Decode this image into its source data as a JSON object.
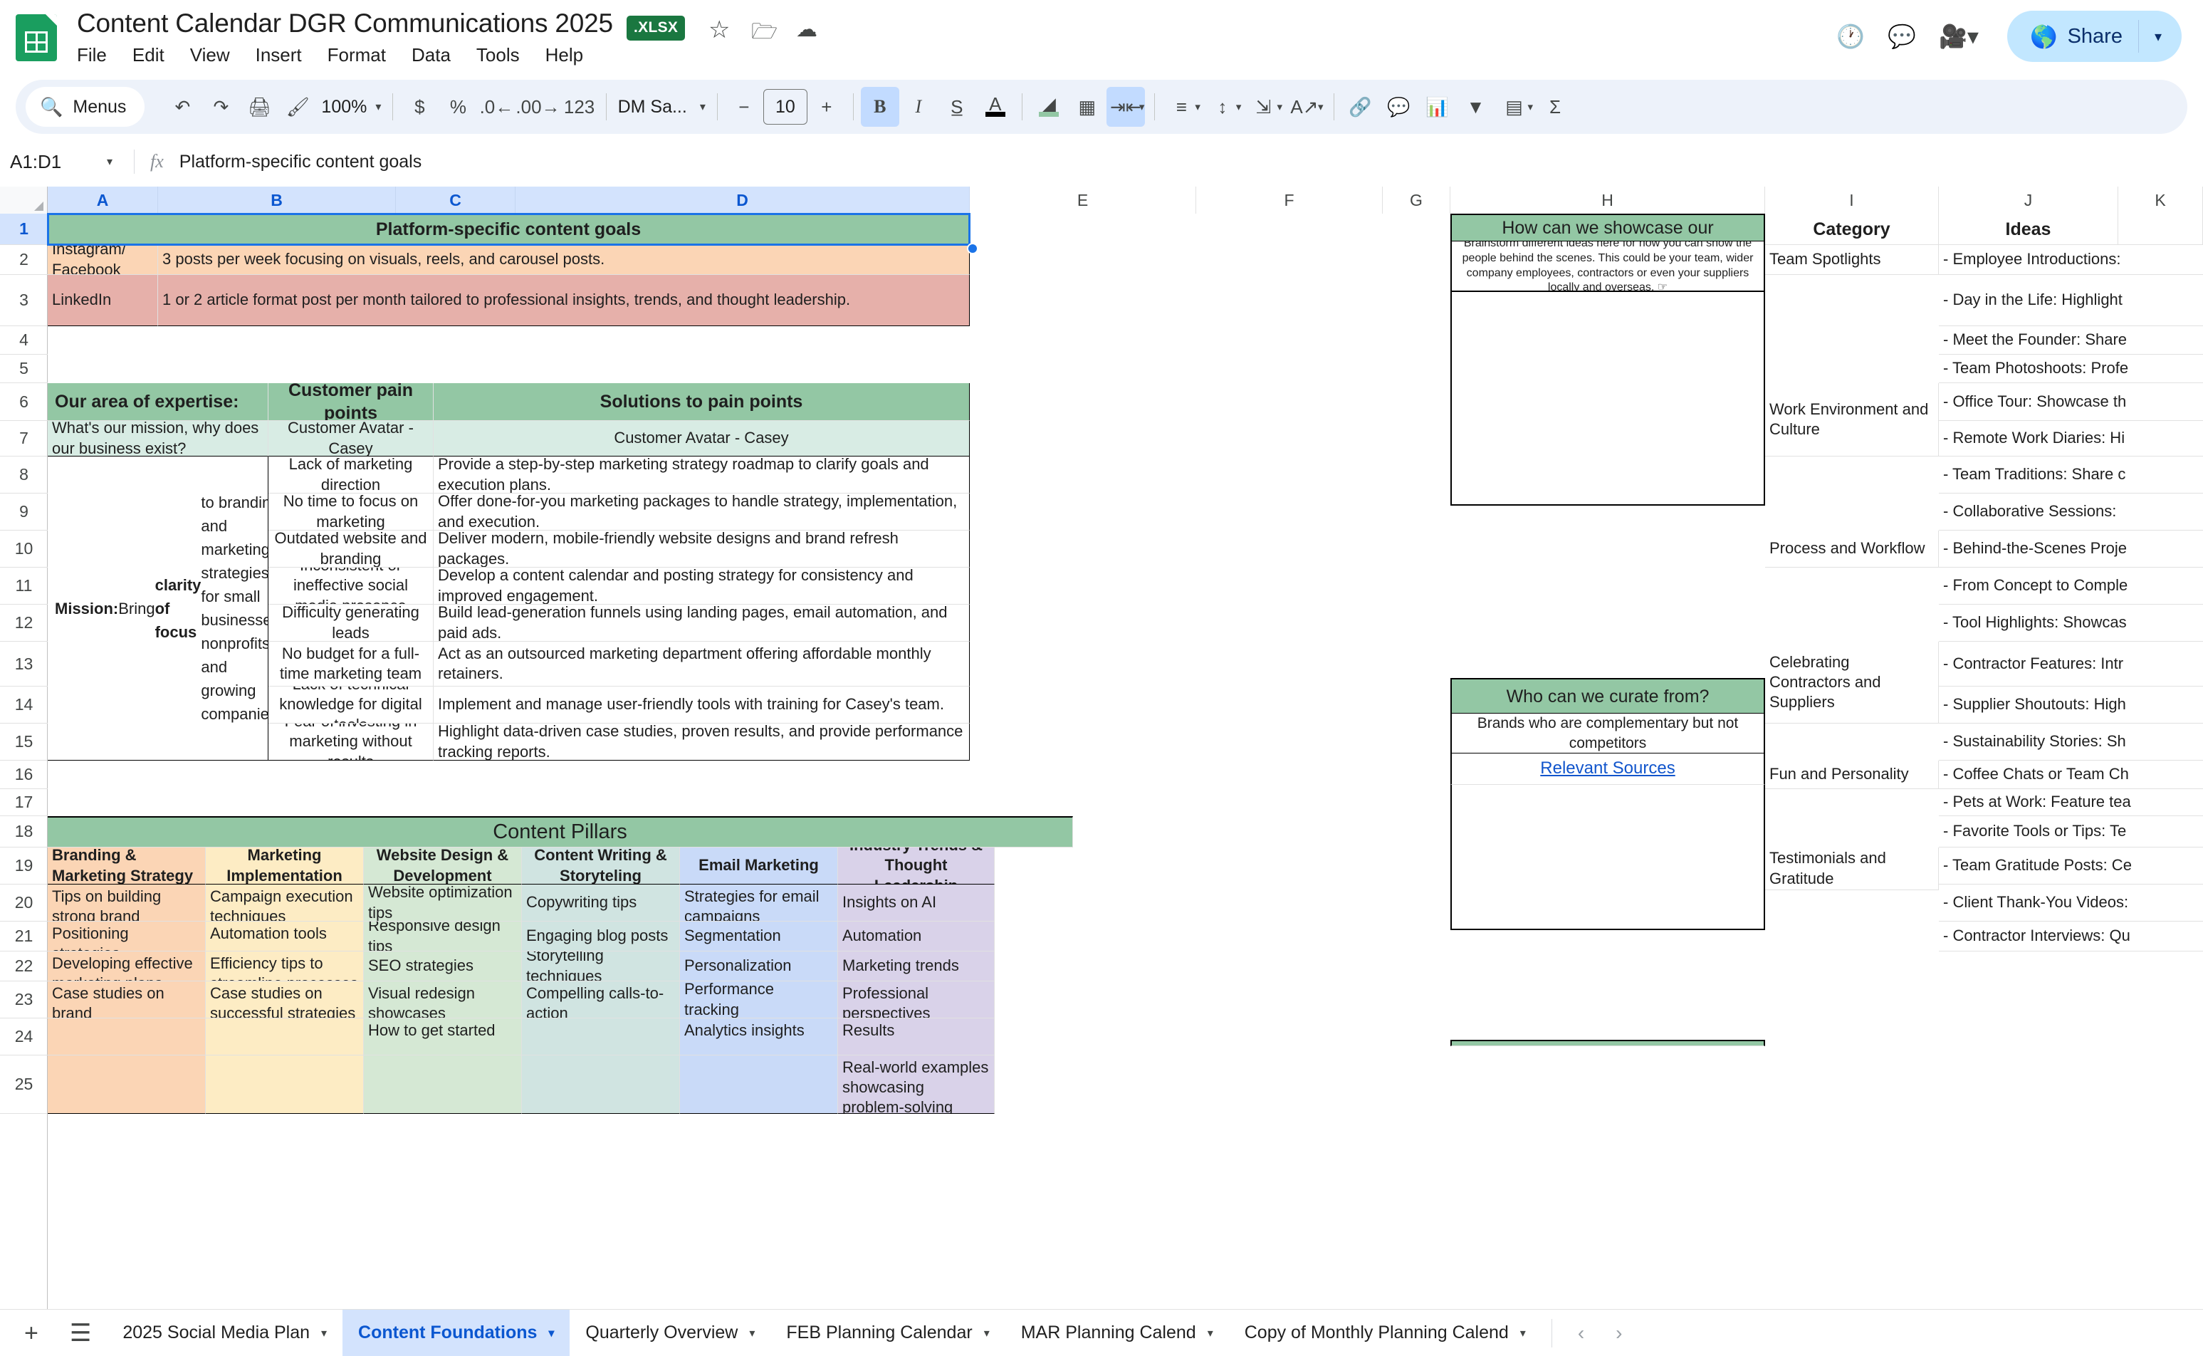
{
  "app": {
    "doc_title": "Content Calendar DGR Communications 2025",
    "format_badge": ".XLSX",
    "menus": [
      "File",
      "Edit",
      "View",
      "Insert",
      "Format",
      "Data",
      "Tools",
      "Help"
    ],
    "share_label": "Share"
  },
  "toolbar": {
    "menus_label": "Menus",
    "zoom": "100%",
    "font": "DM Sa...",
    "font_size": "10"
  },
  "formula_bar": {
    "name_box": "A1:D1",
    "formula": "Platform-specific content goals"
  },
  "grid": {
    "columns": [
      "A",
      "B",
      "C",
      "D",
      "E",
      "F",
      "G",
      "H",
      "I",
      "J",
      "K"
    ],
    "rows": [
      "1",
      "2",
      "3",
      "4",
      "5",
      "6",
      "7",
      "8",
      "9",
      "10",
      "11",
      "12",
      "13",
      "14",
      "15",
      "16",
      "17",
      "18",
      "19",
      "20",
      "21",
      "22",
      "23",
      "24",
      "25"
    ]
  },
  "platform_goals": {
    "title": "Platform-specific content goals",
    "rows": [
      {
        "platform": "Instagram/ Facebook",
        "goal": "3 posts per week focusing on visuals, reels, and carousel posts."
      },
      {
        "platform": "LinkedIn",
        "goal": "1 or 2 article format post per month tailored to professional insights, trends, and thought leadership."
      }
    ]
  },
  "expertise": {
    "headers": [
      "Our area of expertise:",
      "Customer pain points",
      "Solutions to pain points"
    ],
    "subheaders": [
      "What's our mission, why does our business exist?",
      "Customer Avatar - Casey",
      "Customer Avatar - Casey"
    ],
    "mission_text": "Mission: Bring clarity of focus to branding and marketing strategies for small businesses, nonprofits, and growing companies. Purpose: Simplify marketing decisions, elevate online presence, save time and resources, and drive growth through tailored strategies and impactful solutions.",
    "pain_points": [
      "Lack of marketing direction",
      "No time to focus on marketing",
      "Outdated website and branding",
      "Inconsistent or ineffective social media presence",
      "Difficulty generating leads",
      "No budget for a full-time marketing team",
      "Lack of technical knowledge for digital tools",
      "Fear of investing in marketing without results"
    ],
    "solutions": [
      "Provide a step-by-step marketing strategy roadmap to clarify goals and execution plans.",
      "Offer done-for-you marketing packages to handle strategy, implementation, and execution.",
      "Deliver modern, mobile-friendly website designs and brand refresh packages.",
      "Develop a content calendar and posting strategy for consistency and improved engagement.",
      "Build lead-generation funnels using landing pages, email automation, and paid ads.",
      "Act as an outsourced marketing department offering affordable monthly retainers.",
      "Implement and manage user-friendly tools with training for Casey's team.",
      "Highlight data-driven case studies, proven results, and provide performance tracking reports."
    ]
  },
  "content_pillars": {
    "title": "Content Pillars",
    "columns": [
      {
        "header": "Branding & Marketing Strategy",
        "items": [
          "Tips on building strong brand identities",
          "Positioning strategies",
          "Developing effective marketing plans",
          "Case studies on brand transformations"
        ]
      },
      {
        "header": "Marketing Implementation",
        "items": [
          "Campaign execution techniques",
          "Automation tools",
          "Efficiency tips to streamline processes",
          "Case studies on successful strategies"
        ]
      },
      {
        "header": "Website Design & Development",
        "items": [
          "Website optimization tips",
          "Responsive design tips",
          "SEO strategies",
          "Visual redesign showcases",
          "How to get started"
        ]
      },
      {
        "header": "Content Writing & Storyteling",
        "items": [
          "Copywriting tips",
          "Engaging blog posts",
          "Storytelling techniques",
          "Compelling calls-to-action"
        ]
      },
      {
        "header": "Email Marketing",
        "items": [
          "Strategies for email campaigns",
          "Segmentation",
          "Personalization",
          "Performance tracking",
          "Analytics insights"
        ]
      },
      {
        "header": "Industry Trends & Thought Leadership",
        "items": [
          "Insights on AI",
          "Automation",
          "Marketing trends",
          "Professional perspectives",
          "Results",
          "Real-world examples showcasing problem-solving"
        ]
      }
    ]
  },
  "showcase_box": {
    "title": "How can we showcase our",
    "body": "Brainstorm different ideas here for how you can show the people behind the scenes. This could be your team, wider company employees, contractors or even your suppliers locally and overseas. ☞"
  },
  "curate_box": {
    "title": "Who can we curate from?",
    "body": "Brands who are complementary but not competitors",
    "link": "Relevant Sources"
  },
  "ideas_table": {
    "headers": [
      "Category",
      "Ideas"
    ],
    "categories": [
      {
        "name": "Team Spotlights",
        "row": 2
      },
      {
        "name": "Work Environment and Culture",
        "row": 6
      },
      {
        "name": "Process and Workflow",
        "row": 10
      },
      {
        "name": "Celebrating Contractors and Suppliers",
        "row": 13
      },
      {
        "name": "Fun and Personality",
        "row": 16
      },
      {
        "name": "Testimonials and Gratitude",
        "row": 19
      }
    ],
    "ideas": [
      "- Employee Introductions: ",
      "- Day in the Life: Highlight",
      "- Meet the Founder: Share",
      "- Team Photoshoots: Profe",
      "- Office Tour: Showcase th",
      "- Remote Work Diaries: Hi",
      "- Team Traditions: Share c",
      "- Collaborative Sessions: ",
      "- Behind-the-Scenes Proje",
      "- From Concept to Comple",
      "- Tool Highlights: Showcas",
      "- Contractor Features: Intr",
      "- Supplier Shoutouts: High",
      "- Sustainability Stories: Sh",
      "- Coffee Chats or Team Ch",
      "- Pets at Work: Feature tea",
      "- Favorite Tools or Tips: Te",
      "- Team Gratitude Posts: Ce",
      "- Client Thank-You Videos:",
      "- Contractor Interviews: Qu"
    ]
  },
  "sheet_tabs": [
    {
      "label": "2025 Social Media Plan",
      "active": false
    },
    {
      "label": "Content Foundations",
      "active": true
    },
    {
      "label": "Quarterly Overview",
      "active": false
    },
    {
      "label": "FEB Planning Calendar",
      "active": false
    },
    {
      "label": "MAR Planning Calend",
      "active": false
    },
    {
      "label": "Copy of Monthly Planning Calend",
      "active": false
    }
  ],
  "colors": {
    "green_header": "#93c7a4",
    "teal_sub": "#d8ece4",
    "peach": "#fbd5b5",
    "rose": "#e6b0aa",
    "cream": "#fdecc4",
    "mint": "#d5e8d4",
    "lightblue": "#c9daf8",
    "lavender": "#d9d2e9",
    "paleteal": "#d0e4e1",
    "accent_blue": "#1a73e8"
  }
}
